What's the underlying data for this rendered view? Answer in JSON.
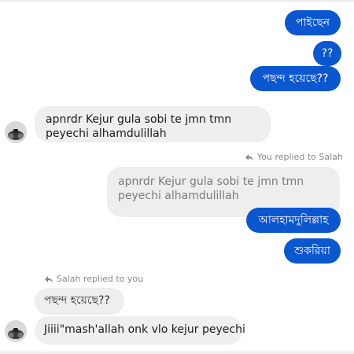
{
  "messages": {
    "out1": "পাইছেন",
    "out2": "??",
    "out3": "পছন্দ হয়েছে??",
    "in1": "apnrdr Kejur gula sobi te jmn tmn peyechi alhamdulillah",
    "reply_meta_you": "You replied to Salah",
    "quoted1": "apnrdr Kejur gula sobi te jmn tmn peyechi alhamdulillah",
    "out4": "আলহামদুলিল্লাহ",
    "out5": "শুকরিয়া",
    "reply_meta_salah": "Salah replied to you",
    "quoted2": "পছন্দ হয়েছে??",
    "in2": "Jiiii\"mash'allah onk vlo kejur peyechi"
  },
  "colors": {
    "outgoing": "#0b57d0",
    "incoming": "#efefef"
  },
  "icons": {
    "reply": "reply-arrow-icon",
    "avatar": "contact-avatar"
  }
}
